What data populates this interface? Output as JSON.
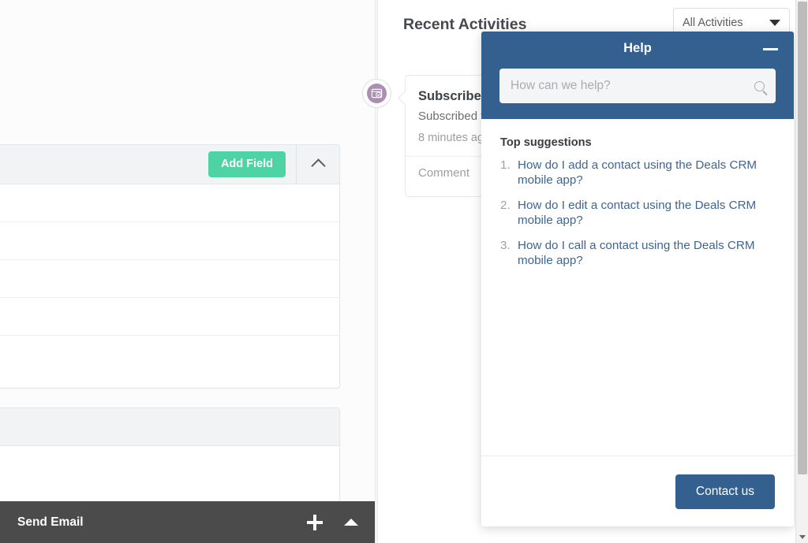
{
  "left_panel": {
    "add_field_label": "Add Field",
    "collapse_icon": "chevron-up-icon"
  },
  "activities": {
    "title": "Recent Activities",
    "filter_label": "All Activities",
    "filter_icon": "caret-down-icon",
    "badge_icon": "subscription-check-icon",
    "item": {
      "heading": "Subscribed",
      "description": "Subscribed t",
      "time": "8 minutes ag",
      "comment_label": "Comment"
    }
  },
  "help": {
    "title": "Help",
    "minimize_icon": "minimize-icon",
    "search": {
      "placeholder": "How can we help?",
      "value": "",
      "icon": "search-icon"
    },
    "suggestions_title": "Top suggestions",
    "suggestions": [
      "How do I add a contact using the Deals CRM mobile app?",
      "How do I edit a contact using the Deals CRM mobile app?",
      "How do I call a contact using the Deals CRM mobile app?"
    ],
    "contact_label": "Contact us",
    "accent_color": "#33608f"
  },
  "compose": {
    "title": "Send Email",
    "move_icon": "move-handle-icon",
    "collapse_icon": "chevron-up-icon"
  }
}
